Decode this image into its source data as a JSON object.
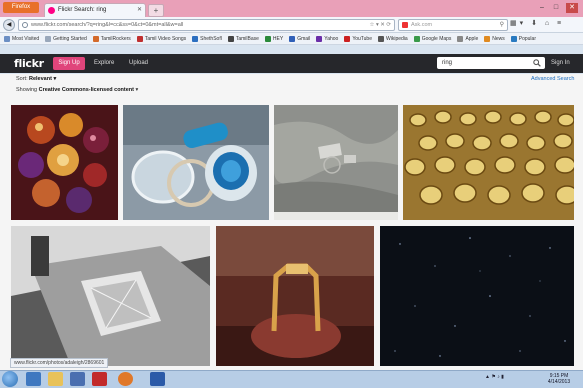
{
  "browser": {
    "app_button_label": "Firefox",
    "tab_title": "Flickr Search: ring",
    "new_tab_label": "+",
    "url": "www.flickr.com/search/?q=ring&l=cc&ss=0&ct=0&mt=all&w=all",
    "search_placeholder": "Ask.com",
    "bookmarks": [
      "Most Visited",
      "Getting Started",
      "TamilRockers",
      "Tamil Video Songs",
      "ShethSofl",
      "TamilBase",
      "HEY",
      "Gmail",
      "Yahoo",
      "YouTube",
      "Wikipedia",
      "Google Maps",
      "Apple",
      "News",
      "Popular"
    ]
  },
  "flickr": {
    "logo": "flickr",
    "signup_label": "Sign Up",
    "explore_label": "Explore",
    "upload_label": "Upload",
    "search_value": "ring",
    "signin_label": "Sign In",
    "sort_label": "Sort:",
    "sort_value": "Relevant",
    "advanced_search_label": "Advanced Search",
    "filter_prefix": "Showing",
    "filter_value": "Creative Commons-licensed content"
  },
  "status_bar_url": "www.flickr.com/photos/adaleigh/2869601",
  "taskbar": {
    "clock_time": "9:15 PM",
    "clock_date": "4/14/2013"
  },
  "colors": {
    "flickr_pink": "#e0457b",
    "flickr_blue": "#1b6dc1",
    "header_bg": "#26272b"
  }
}
